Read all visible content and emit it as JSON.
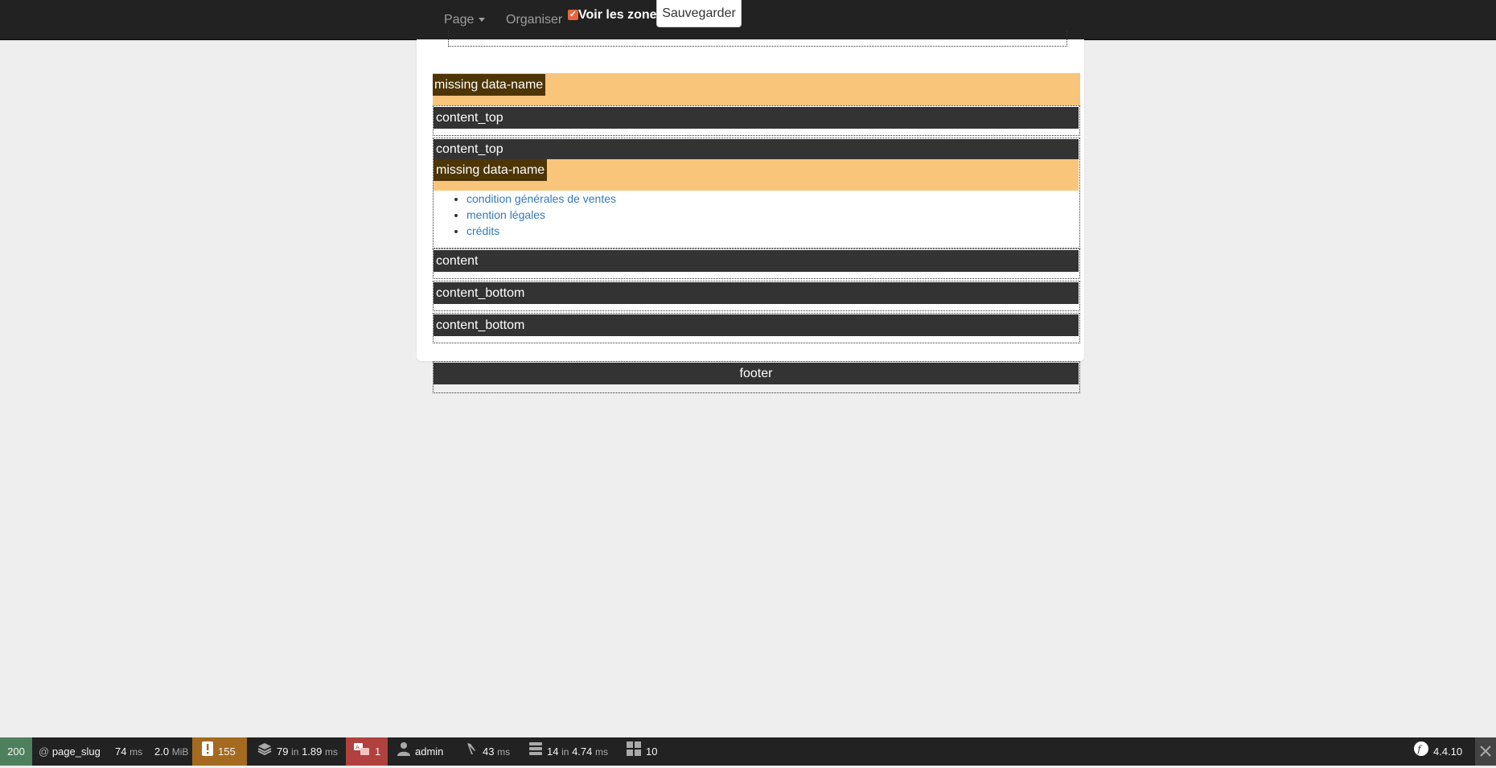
{
  "navbar": {
    "page_menu": "Page",
    "organiser": "Organiser",
    "show_zones": "Voir les zones",
    "save": "Sauvegarder"
  },
  "zones": {
    "missing_1": "missing data-name",
    "content_top_1": "content_top",
    "content_top_2": "content_top",
    "missing_2": "missing data-name",
    "content": "content",
    "content_bottom_1": "content_bottom",
    "content_bottom_2": "content_bottom",
    "footer": "footer"
  },
  "links": [
    "condition générales de ventes",
    "mention légales",
    "crédits"
  ],
  "toolbar": {
    "status": "200",
    "route_prefix": "@",
    "route": "page_slug",
    "time": "74",
    "time_unit": "ms",
    "memory": "2.0",
    "memory_unit": "MiB",
    "logs": "155",
    "forms": "79",
    "forms_in": "in",
    "forms_time": "1.89",
    "forms_unit": "ms",
    "translations": "1",
    "user": "admin",
    "perf": "43",
    "perf_unit": "ms",
    "db_queries": "14",
    "db_in": "in",
    "db_time": "4.74",
    "db_unit": "ms",
    "twig": "10",
    "version": "4.4.10"
  },
  "colors": {
    "navbar": "#222222",
    "missing_zone": "#f9c57b",
    "zone_bar": "#333333",
    "link": "#337ab7",
    "status_ok": "#4f805d",
    "logs_warning": "#a46a1f",
    "translation_error": "#b0413e"
  }
}
